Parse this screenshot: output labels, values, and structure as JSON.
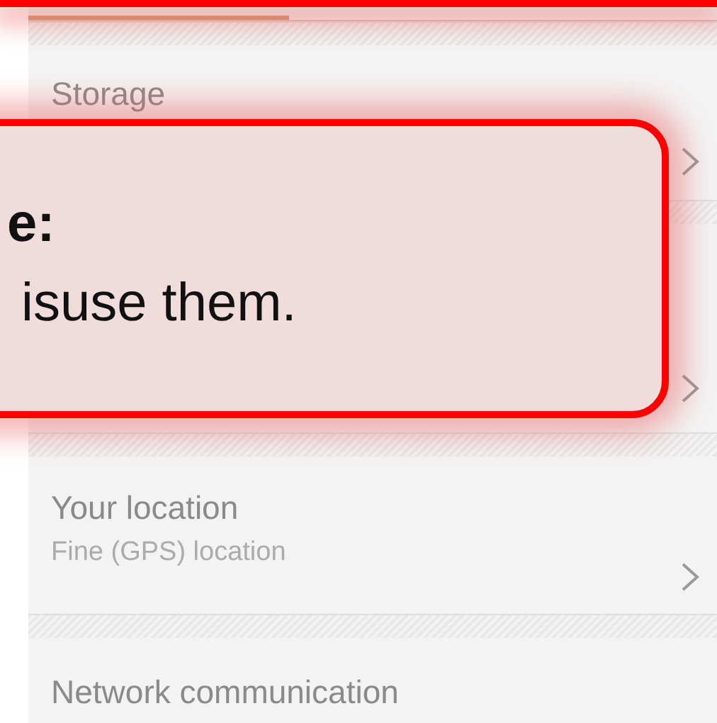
{
  "rows": [
    {
      "title": "Storage",
      "expandable": true
    },
    {
      "expandable": true
    },
    {
      "title": "Your location",
      "subtitle": "Fine (GPS) location",
      "expandable": true
    },
    {
      "title": "Network communication",
      "expandable": false
    }
  ],
  "callout": {
    "lines": [
      {
        "text": "e:",
        "bold": true
      },
      {
        "text": "isuse them.",
        "bold": false
      }
    ]
  }
}
